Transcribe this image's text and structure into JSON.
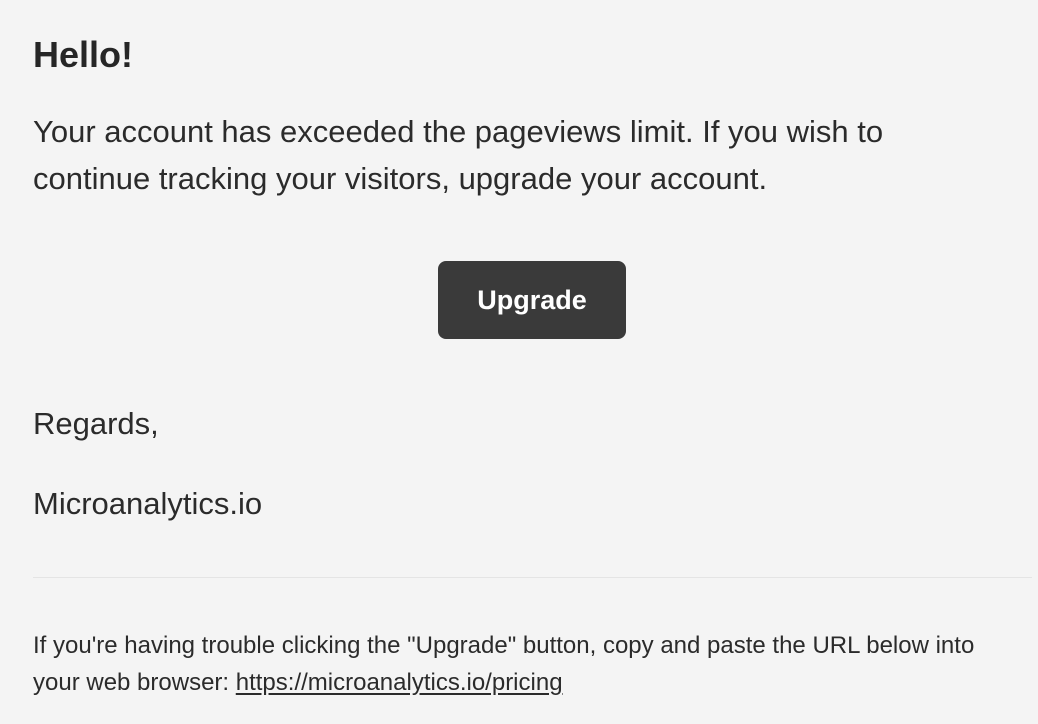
{
  "email": {
    "greeting": "Hello!",
    "intro": "Your account has exceeded the pageviews limit. If you wish to continue tracking your visitors, upgrade your account.",
    "button_label": "Upgrade",
    "salutation": "Regards,",
    "signature": "Microanalytics.io",
    "subcopy_text": "If you're having trouble clicking the \"Upgrade\" button, copy and paste the URL below into your web browser: ",
    "subcopy_link": "https://microanalytics.io/pricing"
  },
  "colors": {
    "background": "#f4f4f4",
    "text": "#2b2b2b",
    "button_background": "#3a3a3a",
    "button_text": "#ffffff",
    "divider": "#e4e4e4"
  }
}
